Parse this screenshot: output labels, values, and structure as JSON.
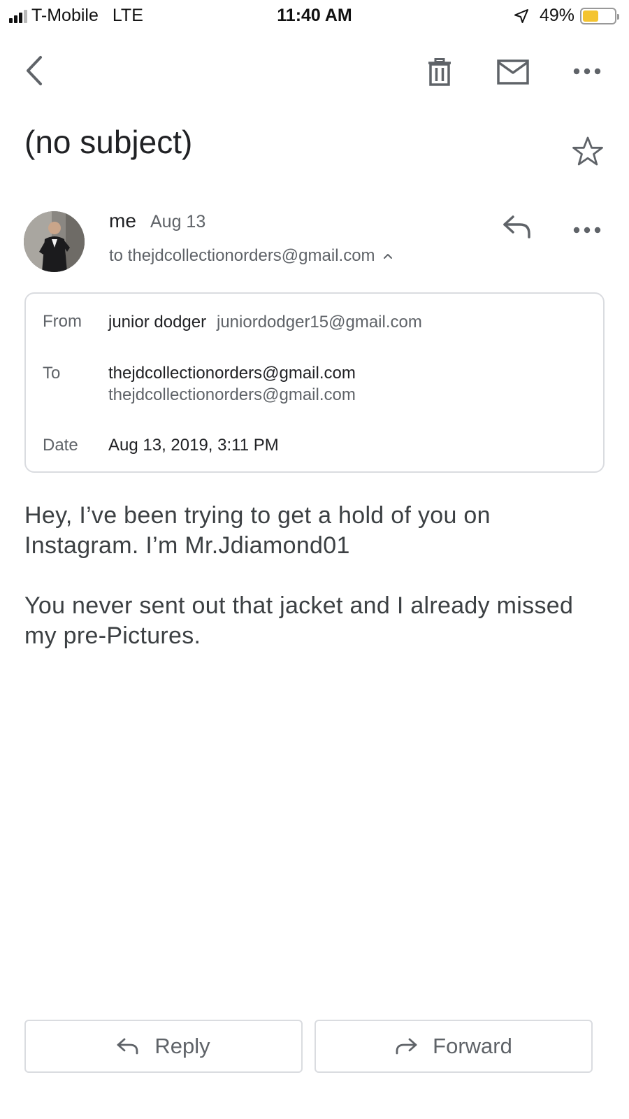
{
  "status_bar": {
    "carrier": "T-Mobile",
    "network": "LTE",
    "time": "11:40 AM",
    "battery_percent": "49%",
    "battery_level": 0.49,
    "signal_bars": 3,
    "icons": [
      "signal-icon",
      "location-arrow-icon",
      "battery-icon"
    ]
  },
  "toolbar": {
    "icons": [
      "back-icon",
      "trash-icon",
      "mail-icon",
      "more-icon"
    ]
  },
  "email": {
    "subject": "(no subject)",
    "sender": "me",
    "date_short": "Aug 13",
    "to_line": "to thejdcollectionorders@gmail.com",
    "details": {
      "from_label": "From",
      "from_name": "junior dodger",
      "from_email": "juniordodger15@gmail.com",
      "to_label": "To",
      "to_name": "thejdcollectionorders@gmail.com",
      "to_email": "thejdcollectionorders@gmail.com",
      "date_label": "Date",
      "date_full": "Aug 13, 2019, 3:11 PM"
    },
    "body": [
      "Hey, I’ve been trying to get a hold of you on Instagram. I’m Mr.Jdiamond01",
      "You never sent out that jacket and I already missed my pre-Pictures."
    ]
  },
  "actions": {
    "reply_label": "Reply",
    "forward_label": "Forward"
  },
  "colors": {
    "battery_fill": "#f4c430",
    "border": "#dadce0",
    "secondary_text": "#5f6368"
  }
}
